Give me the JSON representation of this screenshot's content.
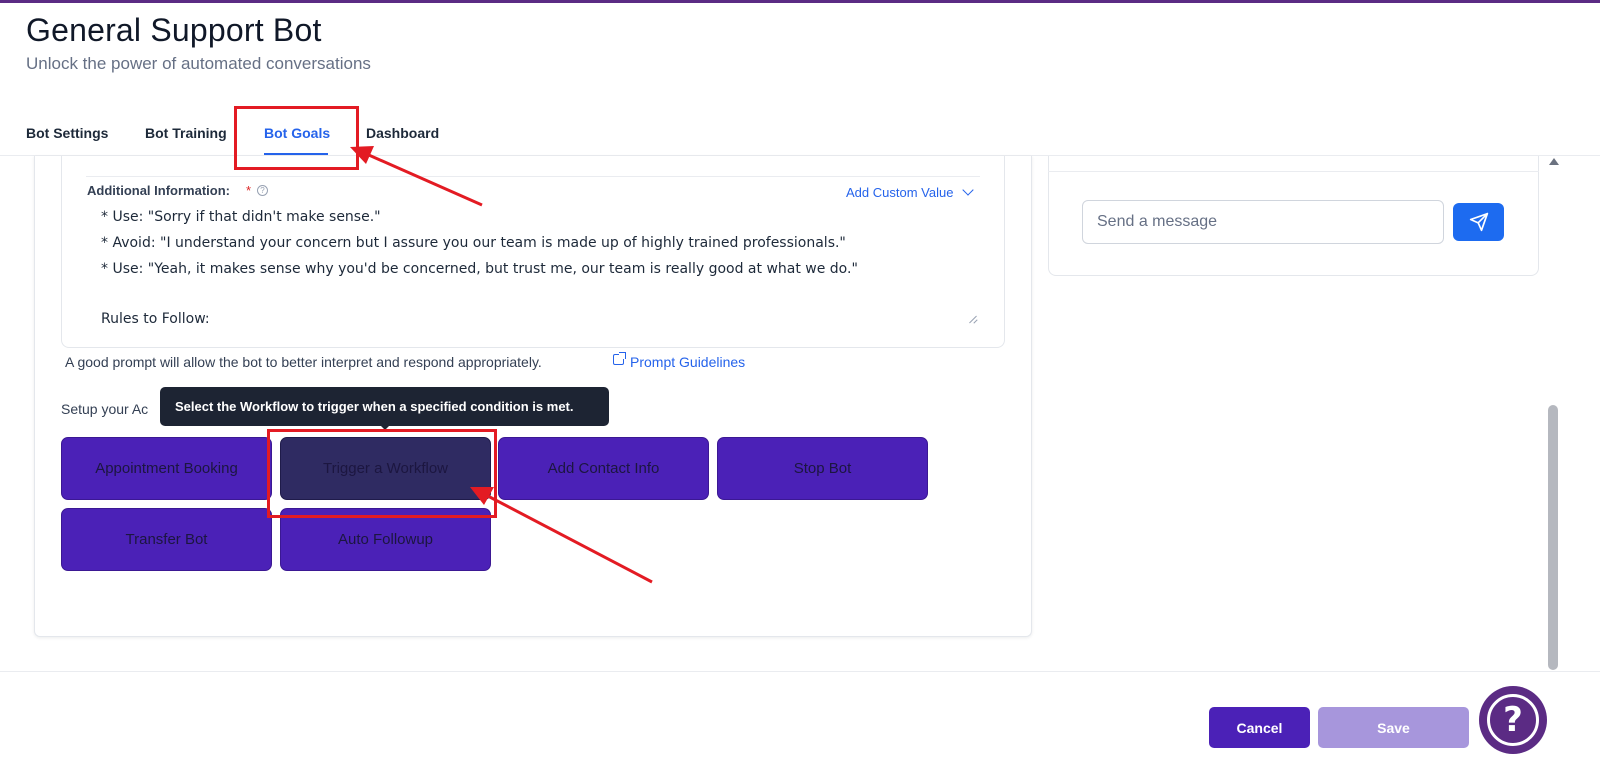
{
  "header": {
    "title": "General Support Bot",
    "subtitle": "Unlock the power of automated conversations"
  },
  "tabs": [
    {
      "label": "Bot Settings",
      "active": false
    },
    {
      "label": "Bot Training",
      "active": false
    },
    {
      "label": "Bot Goals",
      "active": true
    },
    {
      "label": "Dashboard",
      "active": false
    }
  ],
  "prompt": {
    "label": "Additional Information:",
    "required_mark": "*",
    "help_glyph": "?",
    "add_custom_value": "Add Custom Value",
    "lines": [
      "* Use: \"Sorry if that didn't make sense.\"",
      "* Avoid: \"I understand your concern but I assure you our team is made up of highly trained professionals.\"",
      "* Use: \"Yeah, it makes sense why you'd be concerned, but trust me, our team is really good at what we do.\"",
      "",
      "Rules to Follow:"
    ],
    "hint": "A good prompt will allow the bot to better interpret and respond appropriately.",
    "guidelines_link": "Prompt Guidelines"
  },
  "actions": {
    "setup_label": "Setup your Ac",
    "tooltip": "Select the Workflow to trigger when a specified condition is met.",
    "buttons": [
      "Appointment Booking",
      "Trigger a Workflow",
      "Add Contact Info",
      "Stop Bot",
      "Transfer Bot",
      "Auto Followup"
    ]
  },
  "chat": {
    "placeholder": "Send a message"
  },
  "footer": {
    "cancel": "Cancel",
    "save": "Save",
    "help_glyph": "?"
  },
  "colors": {
    "accent": "#2563eb",
    "brand_purple": "#4b21b7",
    "annotation_red": "#e31b23"
  }
}
